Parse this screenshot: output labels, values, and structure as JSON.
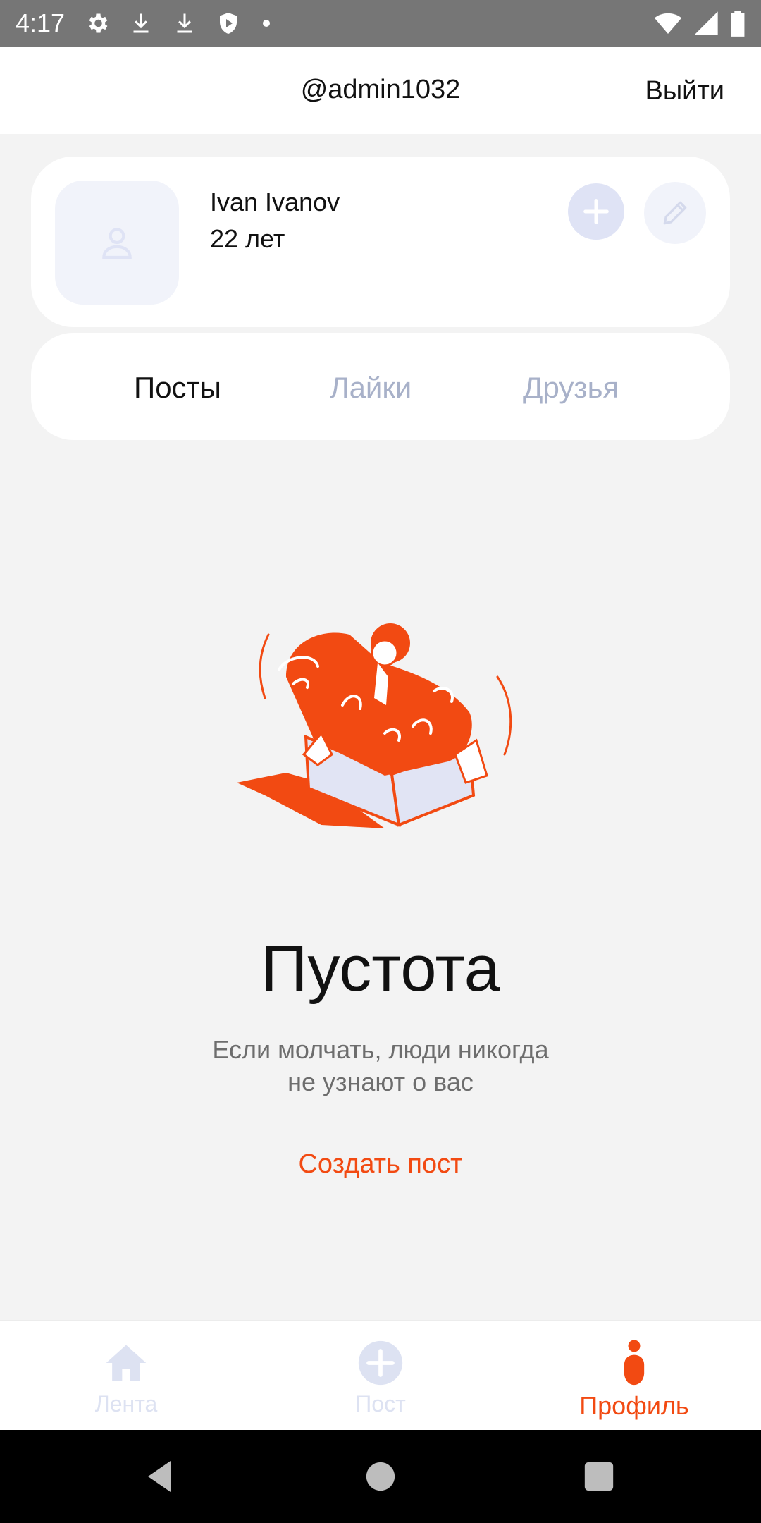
{
  "status_bar": {
    "time": "4:17",
    "left_icons": [
      "settings-icon",
      "download-icon",
      "download-icon",
      "shield-icon",
      "dot-icon"
    ],
    "right_icons": [
      "wifi-icon",
      "signal-icon",
      "battery-icon"
    ]
  },
  "header": {
    "username": "@admin1032",
    "logout_label": "Выйти"
  },
  "profile": {
    "name": "Ivan Ivanov",
    "age": "22 лет",
    "avatar_icon": "user-icon",
    "add_icon": "plus-icon",
    "edit_icon": "pencil-icon"
  },
  "tabs": {
    "posts": "Посты",
    "likes": "Лайки",
    "friends": "Друзья",
    "active": "posts"
  },
  "empty_state": {
    "title": "Пустота",
    "subtitle_line1": "Если молчать, люди никогда",
    "subtitle_line2": "не узнают о вас",
    "action_label": "Создать пост"
  },
  "bottom_nav": {
    "feed_label": "Лента",
    "post_label": "Пост",
    "profile_label": "Профиль",
    "active": "profile"
  },
  "colors": {
    "accent": "#f24a12",
    "inactive": "#dde2f2",
    "tab_inactive": "#a8b1c9",
    "background": "#f3f3f3"
  }
}
